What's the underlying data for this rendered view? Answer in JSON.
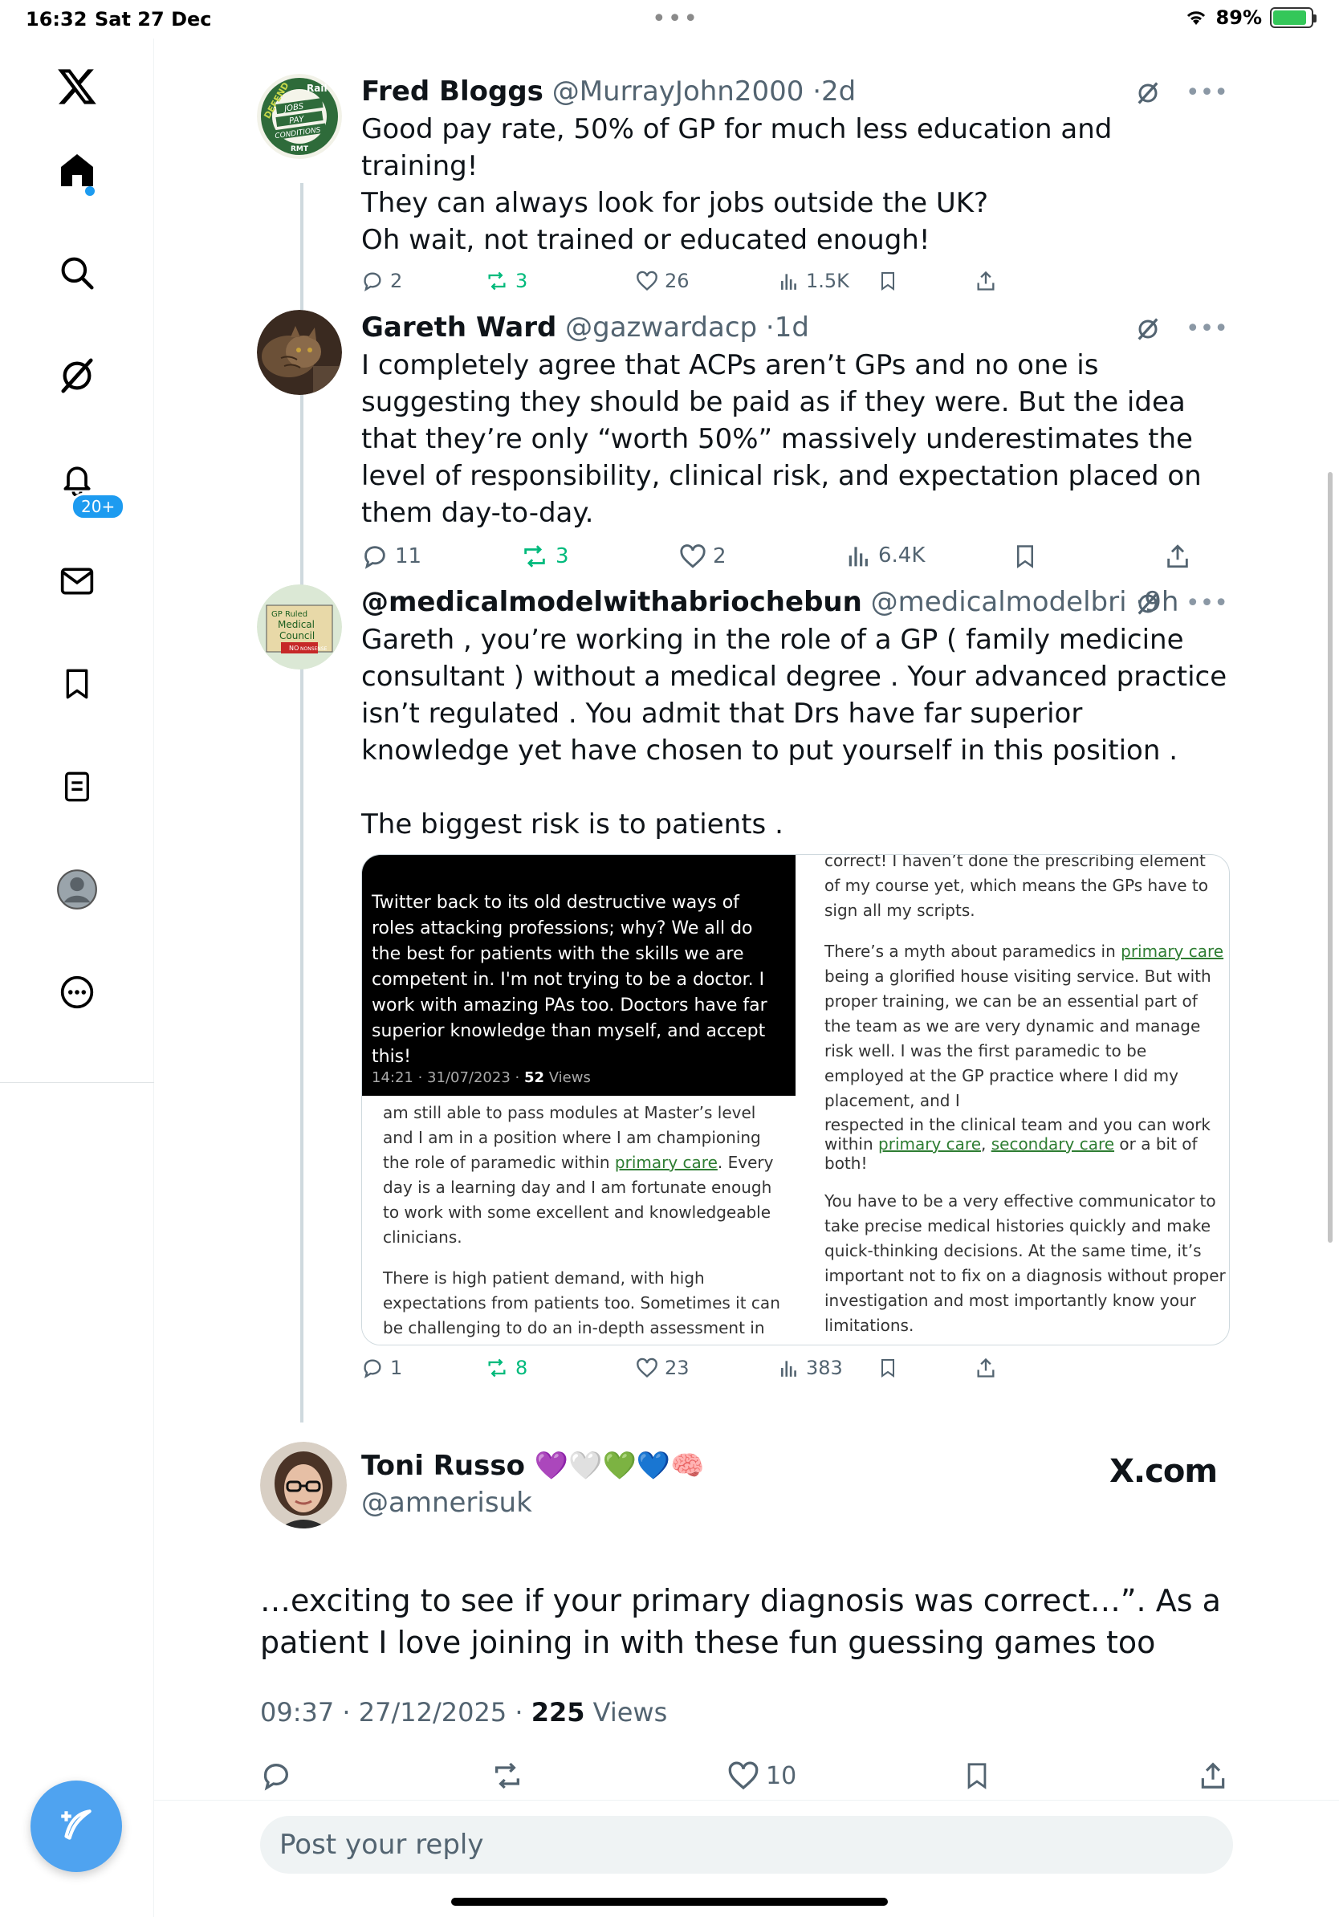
{
  "status_bar": {
    "time": "16:32",
    "date": "Sat 27 Dec",
    "battery": "89%",
    "battery_level": 0.89
  },
  "sidebar": {
    "icons": [
      "x-logo-icon",
      "home-icon",
      "search-icon",
      "grok-icon",
      "notifications-icon",
      "messages-icon",
      "bookmarks-icon",
      "lists-icon",
      "profile-icon",
      "more-icon"
    ],
    "notification_badge": "20+"
  },
  "replies": [
    {
      "name": "Fred Bloggs",
      "handle": "@MurrayJohn2000",
      "time": "2d",
      "text_lines": [
        "Good pay rate, 50% of GP for much less education and training!",
        "They can always look for jobs outside the UK?",
        "Oh wait, not trained or educated enough!"
      ],
      "avatar_text": [
        "DEFEND",
        "Rail",
        "JOBS",
        "PAY",
        "CONDITIONS",
        "RMT"
      ],
      "stats": {
        "replies": "2",
        "reposts": "3",
        "likes": "26",
        "views": "1.5K"
      }
    },
    {
      "name": "Gareth Ward",
      "handle": "@gazwardacp",
      "time": "1d",
      "text": "I completely agree that ACPs aren’t GPs and no one is suggesting they should be paid as if they were. But the idea that they’re only “worth 50%” massively underestimates the level of responsibility, clinical risk, and expectation placed on them day-to-day.",
      "stats": {
        "replies": "11",
        "reposts": "3",
        "likes": "2",
        "views": "6.4K"
      }
    },
    {
      "name": "@medicalmodelwithabriochebun",
      "handle": "@medicalmodelbri",
      "time": "9h",
      "text": "Gareth , you’re working in the role of a GP ( family medicine consultant ) without a medical degree . Your advanced practice isn’t regulated . You admit that Drs have far superior knowledge yet have chosen to put yourself in this position .",
      "text2": "The biggest risk is to patients .",
      "avatar_text": [
        "GP Ruled",
        "Medical",
        "Council",
        "NO",
        "NONSENSE"
      ],
      "media": {
        "dark_text": "Twitter back to its old destructive ways of roles attacking professions; why?  We all do the best for patients with the skills we are competent in. I'm not trying to be a doctor.  I work with amazing PAs too.  Doctors have far superior knowledge than myself, and accept this!",
        "dark_meta_time": "14:21 · 31/07/2023 · ",
        "dark_meta_views_num": "52",
        "dark_meta_views_label": " Views",
        "left_p1_a": "am still able to pass modules at Master’s level and I am in a position where I am championing the role of paramedic within ",
        "left_p1_link": "primary care",
        "left_p1_b": ". Every day is a learning day and I am fortunate enough to work with some excellent and knowledgeable clinicians.",
        "left_p2": "There is high patient demand, with high expectations from patients too. Sometimes it can be challenging to do an in-depth assessment in",
        "right_p1": "correct! I haven’t done the prescribing element of my course yet, which means the GPs have to sign all my scripts.",
        "right_p2_a": "There’s a myth about paramedics in ",
        "right_p2_link": "primary care",
        "right_p2_b": " being a glorified house visiting service. But with proper training, we can be an essential part of the team as we are very dynamic and manage risk well. I was the first paramedic to be employed at the GP practice where I did my placement, and I",
        "right_p3_a": "respected in the clinical team and you can work within ",
        "right_p3_link1": "primary care",
        "right_p3_sep": ", ",
        "right_p3_link2": "secondary care",
        "right_p3_b": " or a bit of both!",
        "right_p4": "You have to be a very effective communicator to take precise medical histories quickly and make quick-thinking decisions. At the same time, it’s important not to fix on a diagnosis without proper investigation and most importantly know your limitations."
      },
      "stats": {
        "replies": "1",
        "reposts": "8",
        "likes": "23",
        "views": "383"
      }
    }
  ],
  "main_tweet": {
    "name": "Toni Russo",
    "name_emojis": [
      "💜",
      "🤍",
      "💚",
      "💙",
      "🧠"
    ],
    "handle": "@amnerisuk",
    "source": "X.com",
    "text": "…exciting to see if your primary diagnosis was correct…”.   As a patient I love joining in with these fun guessing games too",
    "timestamp": "09:37 · 27/12/2025 · ",
    "views_count": "225",
    "views_label": " Views",
    "likes": "10"
  },
  "reply_box": {
    "placeholder": "Post your reply"
  },
  "colors": {
    "accent": "#1d9bf0",
    "repost_green": "#00ba7c",
    "text": "#0f1419",
    "muted": "#536471"
  }
}
